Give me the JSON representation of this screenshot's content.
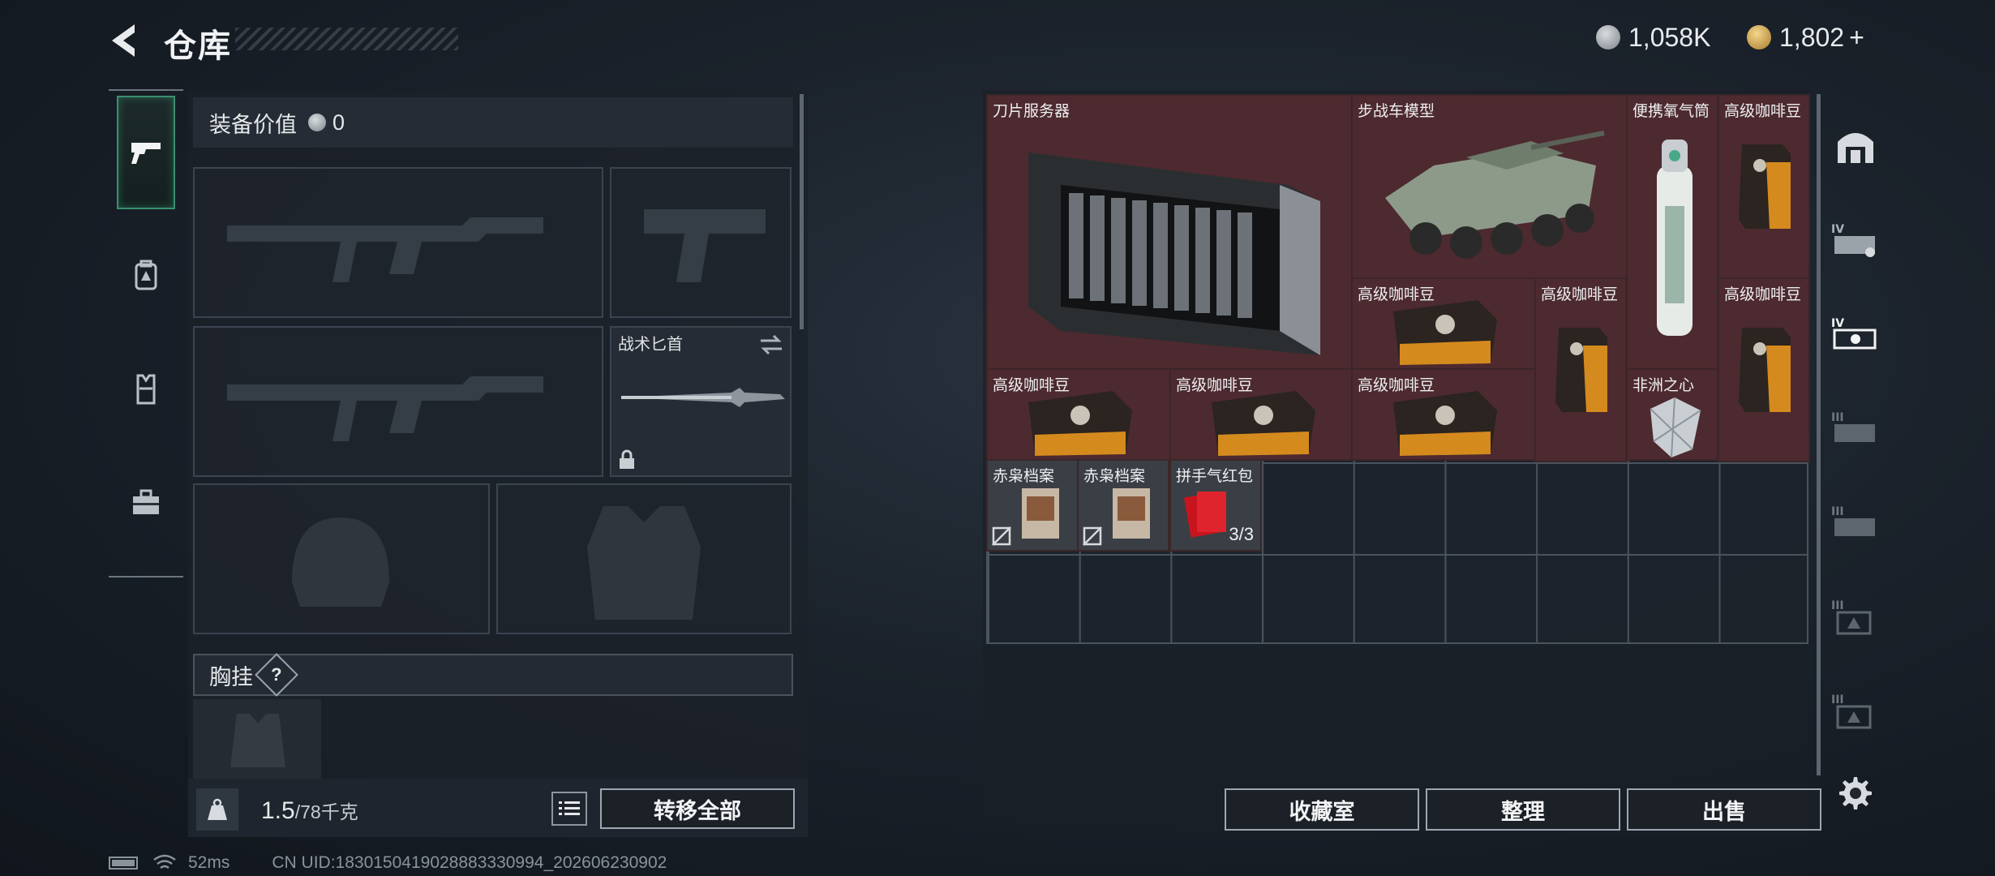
{
  "header": {
    "title": "仓库"
  },
  "currency": {
    "silver": "1,058K",
    "gold": "1,802",
    "plus": "+"
  },
  "left_tabs": [
    "weapon-tab",
    "backpack-tab",
    "armor-tab",
    "toolbox-tab"
  ],
  "equipment": {
    "value_label": "装备价值",
    "value": "0",
    "knife_label": "战术匕首",
    "chest_label": "胸挂",
    "help": "?"
  },
  "weight": {
    "current": "1.5",
    "max": "/78千克"
  },
  "buttons": {
    "transfer_all": "转移全部",
    "collection": "收藏室",
    "organize": "整理",
    "sell": "出售"
  },
  "items": [
    {
      "label": "刀片服务器"
    },
    {
      "label": "步战车模型"
    },
    {
      "label": "便携氧气筒"
    },
    {
      "label": "高级咖啡豆"
    },
    {
      "label": "高级咖啡豆"
    },
    {
      "label": "高级咖啡豆"
    },
    {
      "label": "高级咖啡豆"
    },
    {
      "label": "高级咖啡豆"
    },
    {
      "label": "高级咖啡豆"
    },
    {
      "label": "高级咖啡豆"
    },
    {
      "label": "非洲之心"
    },
    {
      "label": "赤枭档案"
    },
    {
      "label": "赤枭档案"
    },
    {
      "label": "拼手气红包",
      "count": "3/3"
    }
  ],
  "status": {
    "ping": "52ms",
    "uid": "CN UID:1830150419028883330994_202606230902"
  },
  "colors": {
    "accent_green": "#3a8f6e",
    "valuable_red": "#4d2a2f"
  }
}
